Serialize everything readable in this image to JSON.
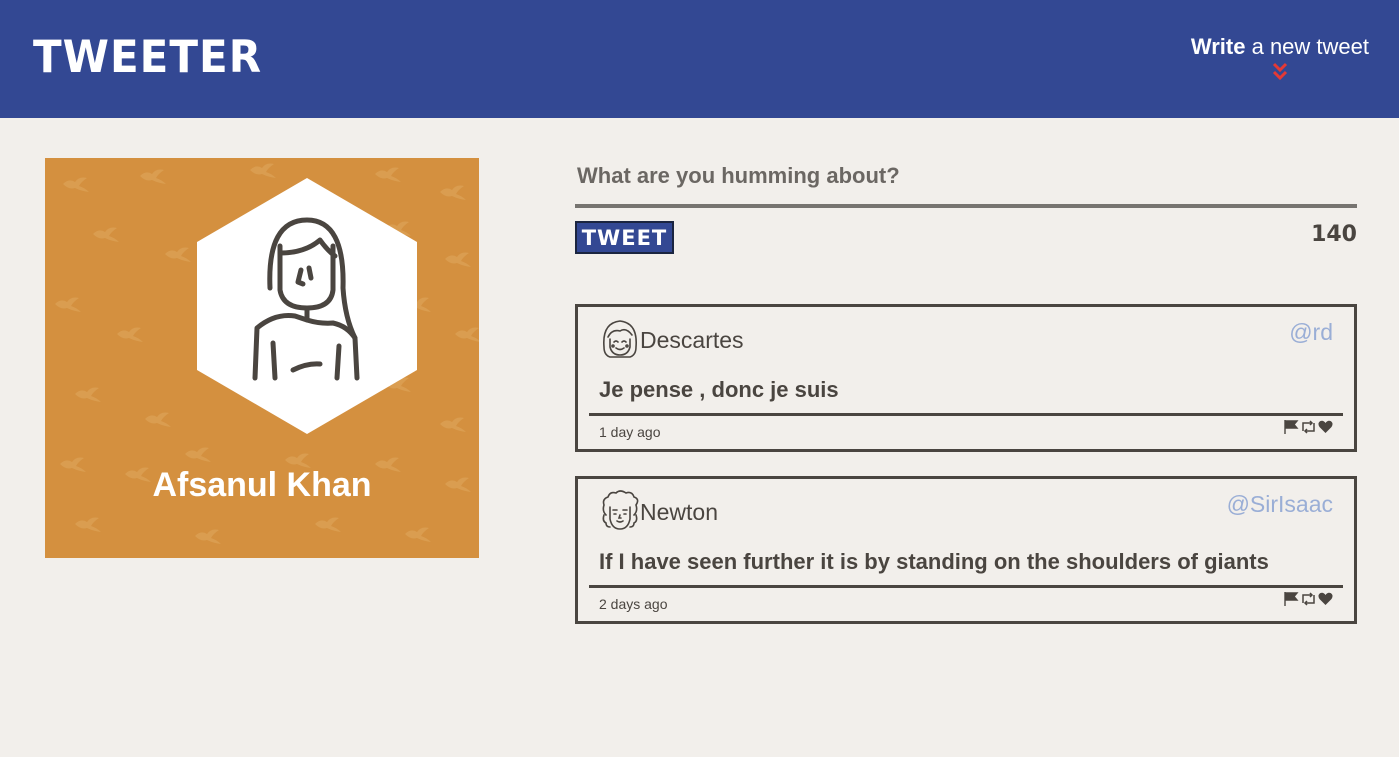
{
  "nav": {
    "logo": "TWEETER",
    "write_bold": "Write",
    "write_rest": " a new tweet",
    "arrow_icon": "double-chevron-down-icon",
    "arrow_color": "#e53935"
  },
  "profile": {
    "name": "Afsanul Khan",
    "background_color": "#d4903f"
  },
  "compose": {
    "placeholder": "What are you humming about?",
    "button_label": "TWEET",
    "counter": "140"
  },
  "tweets": [
    {
      "author": "Descartes",
      "handle": "@rd",
      "content": "Je pense , donc je suis",
      "time": "1 day ago",
      "avatar_icon": "descartes-avatar-icon"
    },
    {
      "author": "Newton",
      "handle": "@SirIsaac",
      "content": "If I have seen further it is by standing on the shoulders of giants",
      "time": "2 days ago",
      "avatar_icon": "newton-avatar-icon"
    }
  ],
  "colors": {
    "nav": "#334893",
    "page": "#f2efeb",
    "text": "#4a4540",
    "handle": "#9aaed6"
  }
}
